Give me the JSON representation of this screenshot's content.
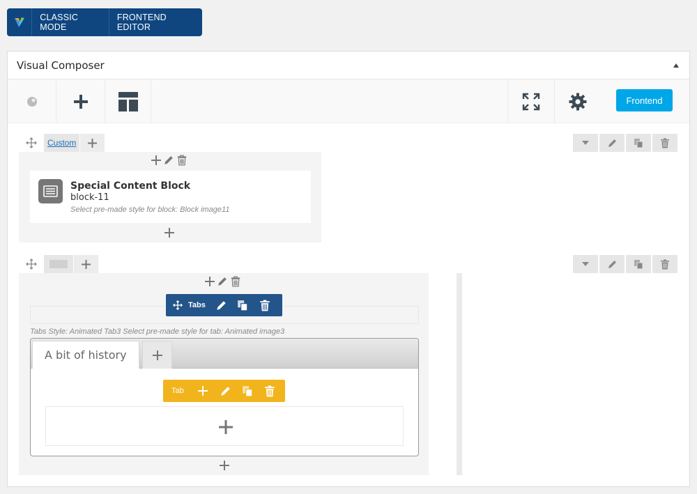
{
  "mode_bar": {
    "classic_label": "CLASSIC MODE",
    "frontend_editor_label": "FRONTEND EDITOR"
  },
  "panel": {
    "title": "Visual Composer"
  },
  "toolbar": {
    "icons": [
      "logo-dot-icon",
      "plus-icon",
      "layout-icon",
      "fullscreen-icon",
      "gear-icon"
    ],
    "frontend_label": "Frontend"
  },
  "row1": {
    "custom_label": "Custom",
    "element": {
      "title": "Special Content Block",
      "subtitle": "block-11",
      "description": "Select pre-made style for block: Block image11"
    }
  },
  "row2": {
    "tabs_label": "Tabs",
    "tabs_style_text": "Tabs Style: Animated Tab3  Select pre-made style for tab: Animated image3",
    "tab_title": "A bit of history",
    "tab_label": "Tab"
  },
  "colors": {
    "mode_bar": "#0f4680",
    "frontend_button": "#00a7e8",
    "tabs_control": "#23548a",
    "tab_control": "#f2b41c"
  }
}
